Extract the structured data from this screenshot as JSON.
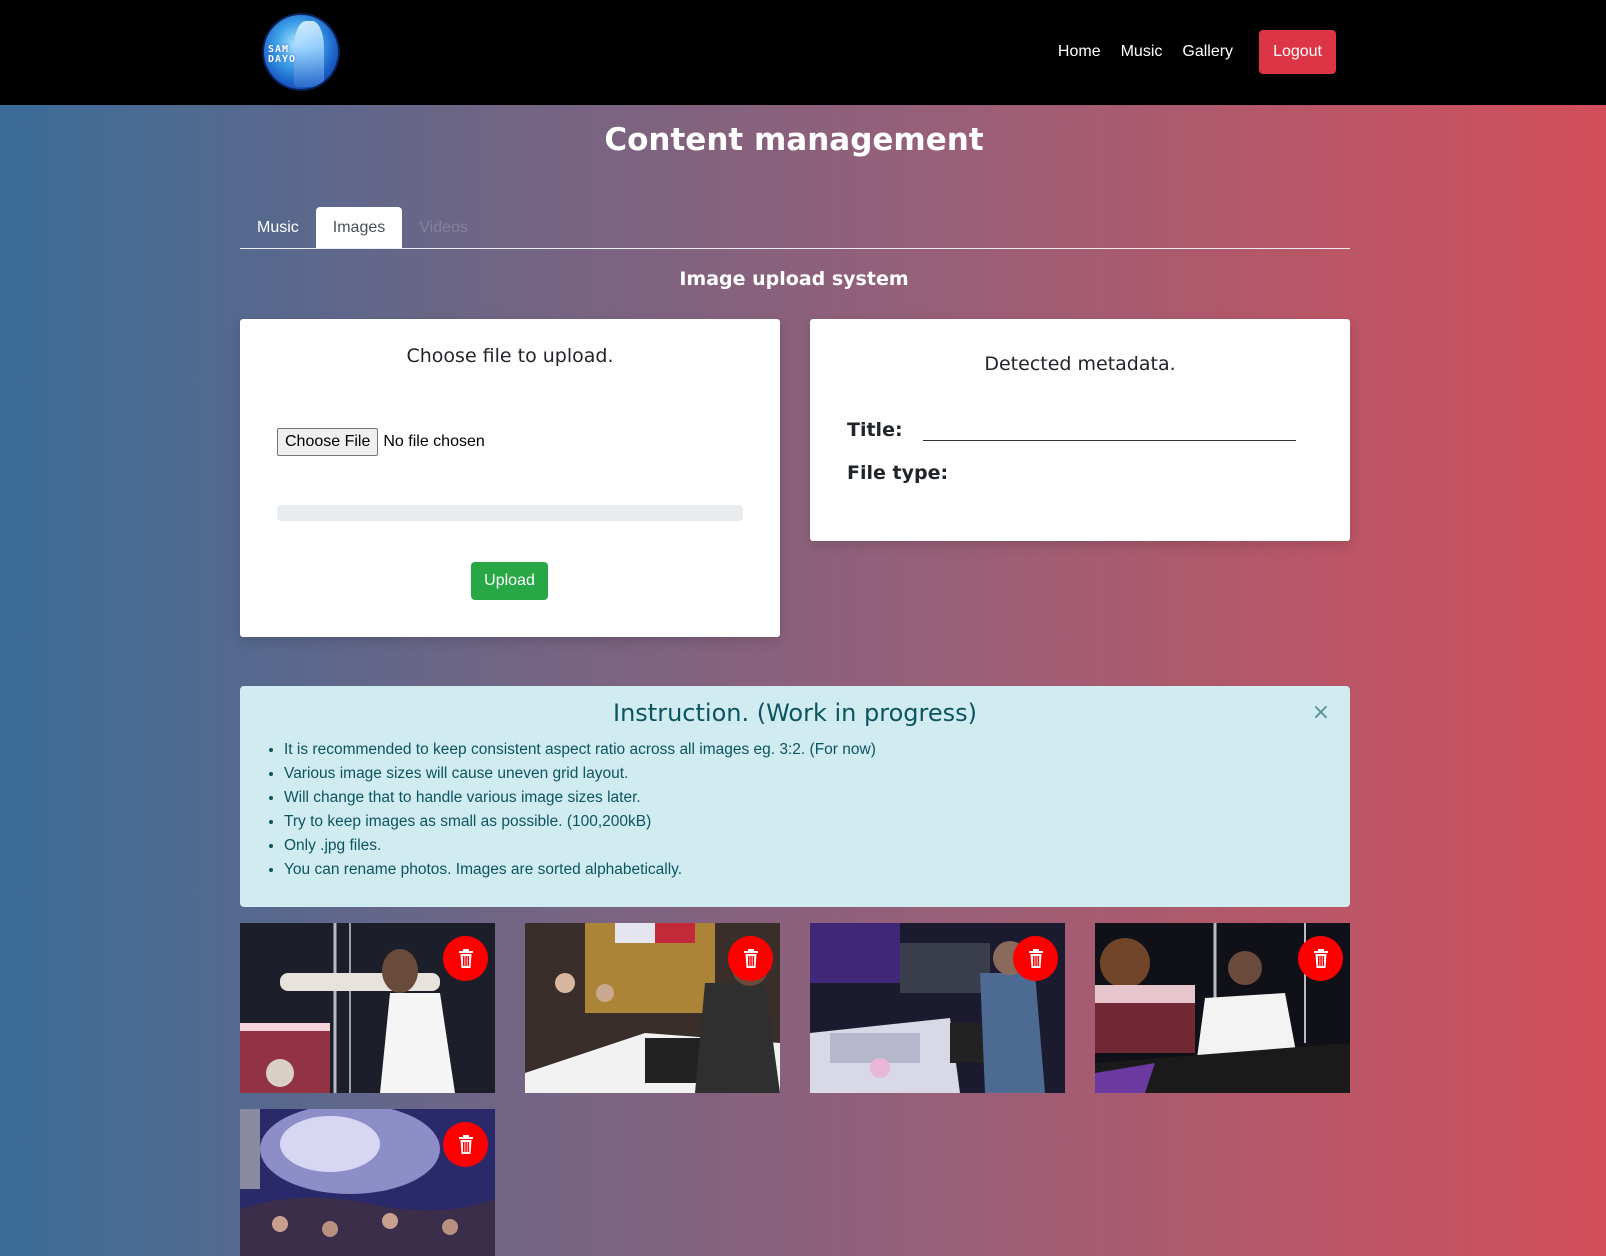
{
  "navbar": {
    "logo_text": "SAM DAYO",
    "links": [
      "Home",
      "Music",
      "Gallery"
    ],
    "logout_label": "Logout"
  },
  "page": {
    "title": "Content management",
    "tabs": [
      {
        "label": "Music",
        "state": "normal"
      },
      {
        "label": "Images",
        "state": "active"
      },
      {
        "label": "Videos",
        "state": "disabled"
      }
    ],
    "section_title": "Image upload system"
  },
  "upload_card": {
    "heading": "Choose file to upload.",
    "choose_file_label": "Choose File",
    "file_status": "No file chosen",
    "progress": 0,
    "upload_label": "Upload"
  },
  "metadata_card": {
    "heading": "Detected metadata.",
    "title_label": "Title:",
    "title_value": "",
    "file_type_label": "File type:",
    "file_type_value": ""
  },
  "instructions": {
    "title": "Instruction. (Work in progress)",
    "close_symbol": "×",
    "items": [
      "It is recommended to keep consistent aspect ratio across all images eg. 3:2. (For now)",
      "Various image sizes will cause uneven grid layout.",
      "Will change that to handle various image sizes later.",
      "Try to keep images as small as possible. (100,200kB)",
      "Only .jpg files.",
      "You can rename photos. Images are sorted alphabetically."
    ]
  },
  "gallery": {
    "count": 5,
    "delete_icon": "trash-icon",
    "colors": {
      "delete": "#ff0000"
    }
  },
  "colors": {
    "navbar": "#000000",
    "logout": "#dc3545",
    "upload": "#28a745",
    "alert_bg": "#d1ecf1",
    "alert_text": "#0c5460",
    "gradient_left": "#3a6d98",
    "gradient_right": "#d24f5a"
  }
}
